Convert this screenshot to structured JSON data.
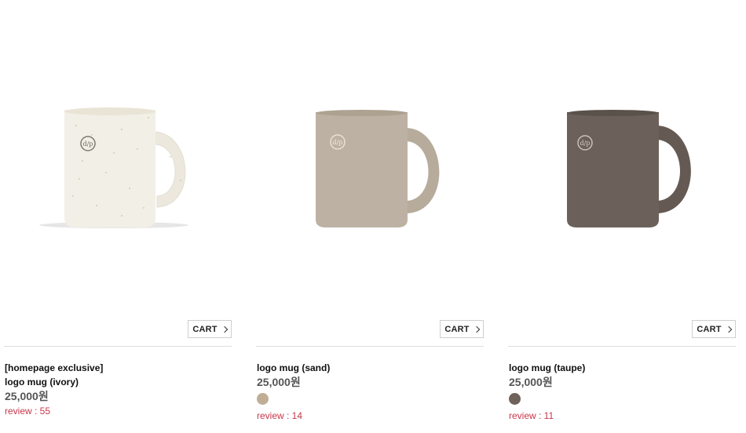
{
  "products": [
    {
      "id_label": "ivory",
      "name_lines": [
        "[homepage exclusive]",
        "logo mug (ivory)"
      ],
      "price": "25,000원",
      "review": "review : 55",
      "cart_label": "CART",
      "mug_color": "#f2efe6",
      "swatch_color": null
    },
    {
      "id_label": "sand",
      "name_lines": [
        "logo mug (sand)"
      ],
      "price": "25,000원",
      "review": "review : 14",
      "cart_label": "CART",
      "mug_color": "#bdb1a3",
      "swatch_color": "#bfae95"
    },
    {
      "id_label": "taupe",
      "name_lines": [
        "logo mug (taupe)"
      ],
      "price": "25,000원",
      "review": "review : 11",
      "cart_label": "CART",
      "mug_color": "#6b615a",
      "swatch_color": "#6f625a"
    }
  ],
  "logo_text": "d/p"
}
